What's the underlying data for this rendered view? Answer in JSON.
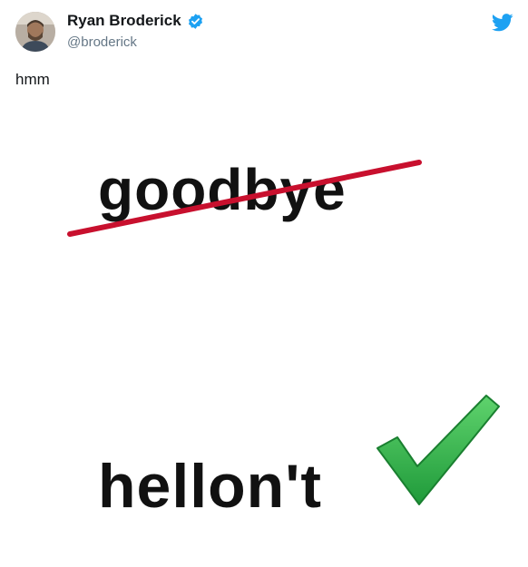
{
  "tweet": {
    "author_name": "Ryan Broderick",
    "author_handle": "@broderick",
    "text": "hmm"
  },
  "media": {
    "crossed_word": "goodbye",
    "checked_word": "hellon't"
  },
  "icons": {
    "verified": "verified-badge-icon",
    "brand": "twitter-bird-icon",
    "strike": "red-strikethrough",
    "check": "green-checkmark-icon"
  },
  "colors": {
    "twitter_blue": "#1da1f2",
    "strike_red": "#c8102e",
    "check_green": "#2bb24c",
    "handle_gray": "#657786"
  }
}
